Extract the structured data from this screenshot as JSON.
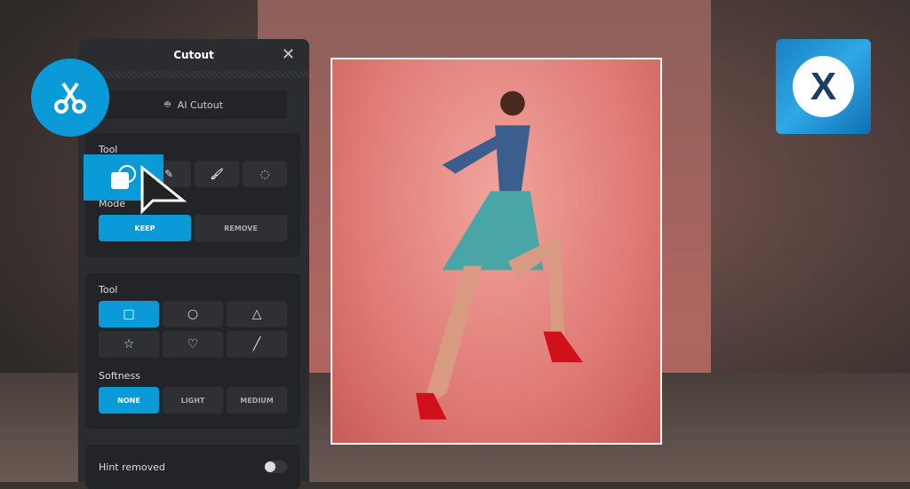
{
  "panel": {
    "title": "Cutout",
    "ai_cutout_label": "AI Cutout",
    "section1": {
      "tool_label": "Tool",
      "mode_label": "Mode",
      "modes": [
        "KEEP",
        "REMOVE"
      ],
      "active_mode": "KEEP"
    },
    "section2": {
      "tool_label": "Tool",
      "shapes": [
        "square",
        "circle",
        "triangle",
        "star",
        "heart",
        "line"
      ],
      "active_shape": "square",
      "softness_label": "Softness",
      "softness": [
        "NONE",
        "LIGHT",
        "MEDIUM"
      ],
      "active_softness": "NONE"
    },
    "hint": {
      "label": "Hint removed",
      "enabled": false
    }
  },
  "brand": {
    "logo_letter": "X",
    "accent": "#0b9ad8"
  }
}
